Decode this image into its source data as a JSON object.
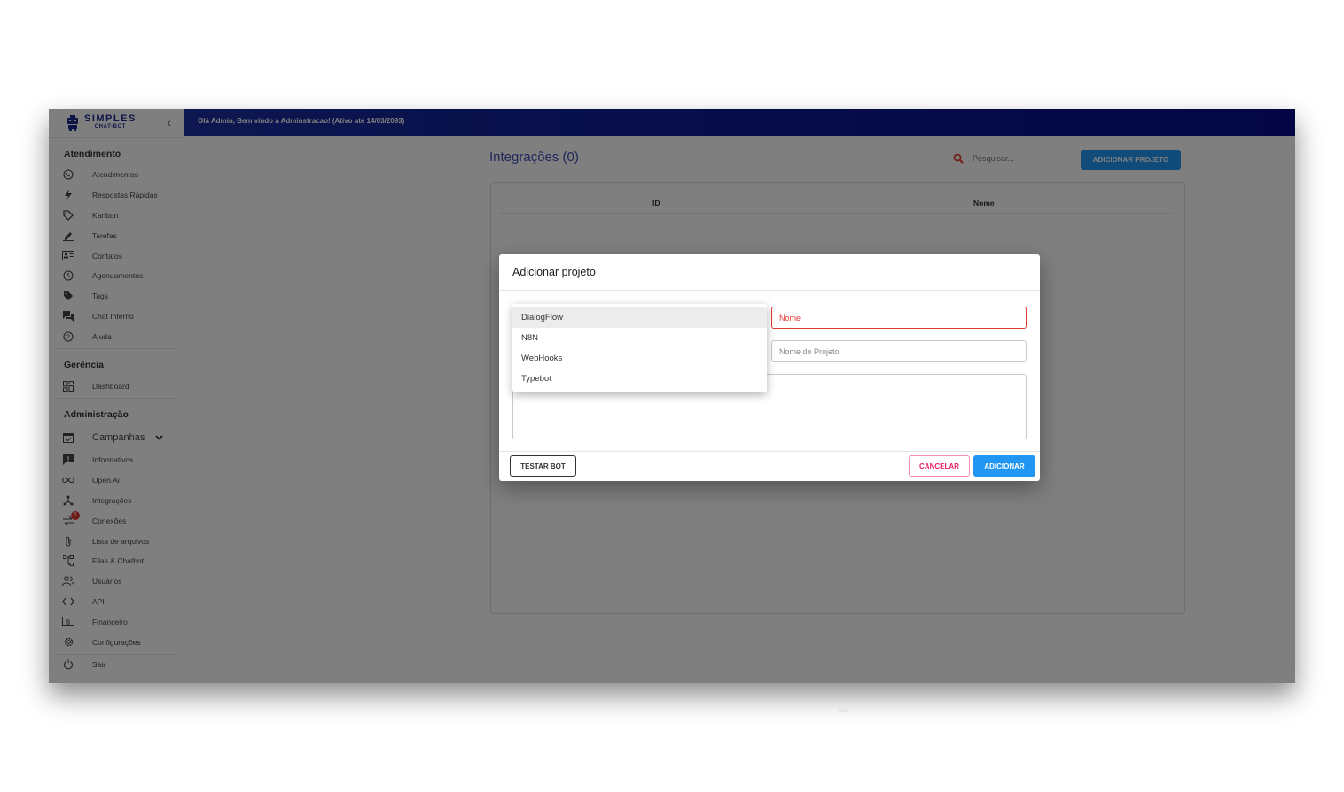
{
  "brand": {
    "line1": "SIMPLES",
    "line2": "CHAT-BOT",
    "collapse_icon": "chevron-left-icon"
  },
  "topbar": {
    "welcome": "Olá Admin, Bem vindo a Adminstracao! (Ativo até 14/03/2093)",
    "gradient_start": "#1b2ea0",
    "gradient_end": "#060d86"
  },
  "sidebar": {
    "sections": {
      "atendimento": "Atendimento",
      "gerencia": "Gerência",
      "administracao": "Administração"
    },
    "atendimento_items": [
      {
        "label": "Atendimentos",
        "icon": "whatsapp-icon"
      },
      {
        "label": "Respostas Rápidas",
        "icon": "bolt-icon"
      },
      {
        "label": "Kanban",
        "icon": "tag-outline-icon"
      },
      {
        "label": "Tarefas",
        "icon": "pencil-icon"
      },
      {
        "label": "Contatos",
        "icon": "contact-card-icon"
      },
      {
        "label": "Agendamentos",
        "icon": "clock-icon"
      },
      {
        "label": "Tags",
        "icon": "tag-icon"
      },
      {
        "label": "Chat Interno",
        "icon": "forum-icon"
      },
      {
        "label": "Ajuda",
        "icon": "help-icon"
      }
    ],
    "gerencia_items": [
      {
        "label": "Dashboard",
        "icon": "dashboard-icon"
      }
    ],
    "administracao_items": [
      {
        "label": "Campanhas",
        "icon": "calendar-check-icon"
      },
      {
        "label": "Informativos",
        "icon": "announcement-icon"
      },
      {
        "label": "Open.Ai",
        "icon": "infinity-icon"
      },
      {
        "label": "Integrações",
        "icon": "hub-icon"
      },
      {
        "label": "Conexões",
        "icon": "sync-alt-icon",
        "badge": "!"
      },
      {
        "label": "Lista de arquivos",
        "icon": "paperclip-icon"
      },
      {
        "label": "Filas & Chatbot",
        "icon": "account-tree-icon"
      },
      {
        "label": "Usuários",
        "icon": "people-icon"
      },
      {
        "label": "API",
        "icon": "code-icon"
      },
      {
        "label": "Financeiro",
        "icon": "money-icon"
      },
      {
        "label": "Configurações",
        "icon": "gear-icon"
      }
    ],
    "logout": {
      "label": "Sair",
      "icon": "power-icon"
    }
  },
  "main": {
    "title": "Integrações (0)",
    "search_placeholder": "Pesquisar...",
    "add_project_button": "ADICIONAR PROJETO",
    "table": {
      "columns": [
        "ID",
        "Nome"
      ]
    }
  },
  "dialog": {
    "title": "Adicionar projeto",
    "type_options": [
      "DialogFlow",
      "N8N",
      "WebHooks",
      "Typebot"
    ],
    "selected_option": "DialogFlow",
    "name_placeholder": "Nome",
    "project_name_placeholder": "Nome do Projeto",
    "test_button": "TESTAR BOT",
    "cancel_button": "CANCELAR",
    "confirm_button": "ADICIONAR"
  },
  "colors": {
    "accent": "#2196f3",
    "title": "#3f51b5",
    "error": "#e53935",
    "cancel": "#e91e63"
  }
}
